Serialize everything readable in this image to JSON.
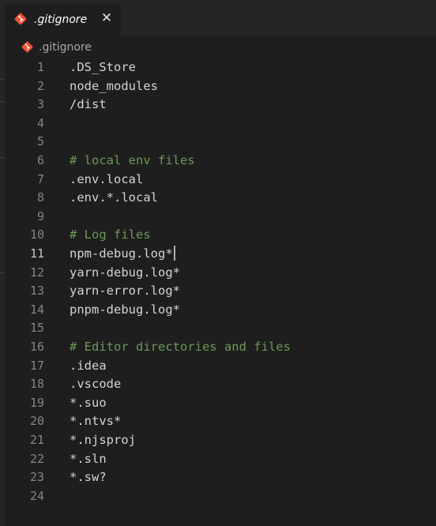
{
  "tab": {
    "label": ".gitignore",
    "icon": "git-diamond-icon",
    "icon_color": "#f05033",
    "close_glyph": "✕"
  },
  "breadcrumb": {
    "label": ".gitignore",
    "icon": "git-diamond-icon"
  },
  "editor": {
    "active_line": 11,
    "comment_color": "#6a9955",
    "text_color": "#d4d4d4",
    "lines": [
      {
        "num": "1",
        "text": ".DS_Store",
        "kind": "text"
      },
      {
        "num": "2",
        "text": "node_modules",
        "kind": "text"
      },
      {
        "num": "3",
        "text": "/dist",
        "kind": "text"
      },
      {
        "num": "4",
        "text": "",
        "kind": "text"
      },
      {
        "num": "5",
        "text": "",
        "kind": "text"
      },
      {
        "num": "6",
        "text": "# local env files",
        "kind": "comment"
      },
      {
        "num": "7",
        "text": ".env.local",
        "kind": "text"
      },
      {
        "num": "8",
        "text": ".env.*.local",
        "kind": "text"
      },
      {
        "num": "9",
        "text": "",
        "kind": "text"
      },
      {
        "num": "10",
        "text": "# Log files",
        "kind": "comment"
      },
      {
        "num": "11",
        "text": "npm-debug.log*",
        "kind": "text"
      },
      {
        "num": "12",
        "text": "yarn-debug.log*",
        "kind": "text"
      },
      {
        "num": "13",
        "text": "yarn-error.log*",
        "kind": "text"
      },
      {
        "num": "14",
        "text": "pnpm-debug.log*",
        "kind": "text"
      },
      {
        "num": "15",
        "text": "",
        "kind": "text"
      },
      {
        "num": "16",
        "text": "# Editor directories and files",
        "kind": "comment"
      },
      {
        "num": "17",
        "text": ".idea",
        "kind": "text"
      },
      {
        "num": "18",
        "text": ".vscode",
        "kind": "text"
      },
      {
        "num": "19",
        "text": "*.suo",
        "kind": "text"
      },
      {
        "num": "20",
        "text": "*.ntvs*",
        "kind": "text"
      },
      {
        "num": "21",
        "text": "*.njsproj",
        "kind": "text"
      },
      {
        "num": "22",
        "text": "*.sln",
        "kind": "text"
      },
      {
        "num": "23",
        "text": "*.sw?",
        "kind": "text"
      },
      {
        "num": "24",
        "text": "",
        "kind": "text"
      }
    ]
  }
}
